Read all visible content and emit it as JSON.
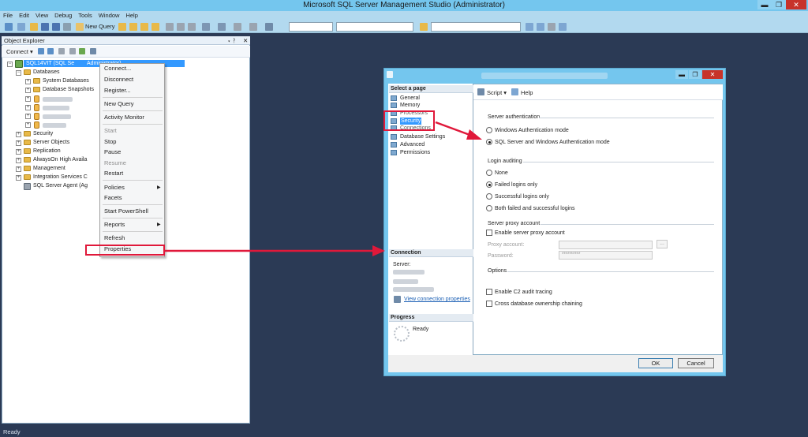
{
  "window": {
    "title": "Microsoft SQL Server Management Studio (Administrator)",
    "min_glyph": "▬",
    "max_glyph": "❐",
    "close_glyph": "✕"
  },
  "menu": [
    "File",
    "Edit",
    "View",
    "Debug",
    "Tools",
    "Window",
    "Help"
  ],
  "toolbar": {
    "new_query": "New Query"
  },
  "object_explorer": {
    "title": "Object Explorer",
    "pin_glyph": "▾ ᚹ",
    "close_glyph": "✕",
    "connect_label": "Connect ▾",
    "server_node": "SQL14VIT (SQL Se",
    "server_node_tail": "                Administrator)",
    "tree": {
      "databases": "Databases",
      "system_databases": "System Databases",
      "database_snapshots": "Database Snapshots",
      "security": "Security",
      "server_objects": "Server Objects",
      "replication": "Replication",
      "alwayson": "AlwaysOn High Availa",
      "management": "Management",
      "integration": "Integration Services C",
      "agent": "SQL Server Agent (Ag"
    }
  },
  "context_menu": {
    "connect": "Connect...",
    "disconnect": "Disconnect",
    "register": "Register...",
    "new_query": "New Query",
    "activity_monitor": "Activity Monitor",
    "start": "Start",
    "stop": "Stop",
    "pause": "Pause",
    "resume": "Resume",
    "restart": "Restart",
    "policies": "Policies",
    "facets": "Facets",
    "start_powershell": "Start PowerShell",
    "reports": "Reports",
    "refresh": "Refresh",
    "properties": "Properties",
    "submenu_glyph": "▶"
  },
  "dialog": {
    "min_glyph": "▬",
    "max_glyph": "❐",
    "close_glyph": "✕",
    "select_page": "Select a page",
    "pages": [
      "General",
      "Memory",
      "Processors",
      "Security",
      "Connections",
      "Database Settings",
      "Advanced",
      "Permissions"
    ],
    "script": "Script ▾",
    "help": "Help",
    "server_authentication": "Server authentication",
    "windows_auth": "Windows Authentication mode",
    "mixed_auth": "SQL Server and Windows Authentication mode",
    "login_auditing": "Login auditing",
    "audit_none": "None",
    "audit_failed": "Failed logins only",
    "audit_success": "Successful logins only",
    "audit_both": "Both failed and successful logins",
    "proxy_account_group": "Server proxy account",
    "enable_proxy": "Enable server proxy account",
    "proxy_account": "Proxy account:",
    "password": "Password:",
    "password_value": "**********",
    "browse": "...",
    "options": "Options",
    "c2_audit": "Enable C2 audit tracing",
    "cross_db": "Cross database ownership chaining",
    "connection_head": "Connection",
    "server_label": "Server:",
    "view_conn_props": "View connection properties",
    "progress_head": "Progress",
    "progress_status": "Ready",
    "ok": "OK",
    "cancel": "Cancel"
  },
  "status": {
    "text": "Ready"
  },
  "colors": {
    "accent_red": "#e0183a",
    "title_blue": "#74c6ee",
    "selection_blue": "#3399ff"
  }
}
